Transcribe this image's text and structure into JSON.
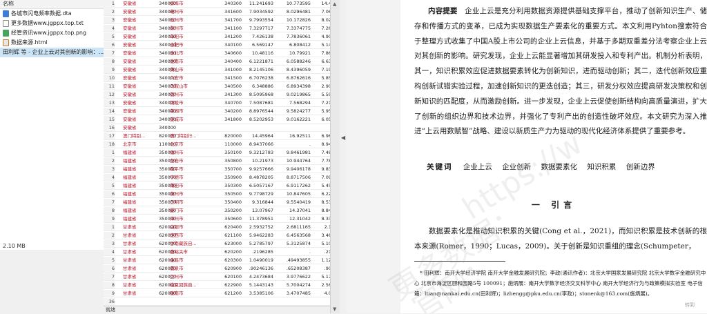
{
  "file_explorer": {
    "column_header": "名称",
    "files": [
      {
        "name": "各城市闪电频率数据.dta",
        "icon": "stata-dta-icon",
        "selected": false
      },
      {
        "name": "更多数据www.jgppx.top.txt",
        "icon": "text-file-icon",
        "selected": false
      },
      {
        "name": "经管资讯www.jgppx.top.png",
        "icon": "image-file-icon",
        "selected": false
      },
      {
        "name": "数据来源.html",
        "icon": "html-file-icon",
        "selected": false
      },
      {
        "name": "田利辉 等 - 企业上云对其创新的影响：...",
        "icon": "pdf-file-icon",
        "selected": true
      }
    ],
    "status_size": "2.10 MB"
  },
  "data_grid": {
    "rows": [
      {
        "n": "1",
        "prov": "安徽省",
        "pcode": "340000",
        "city": "蚌埠市",
        "ccode": "340300",
        "v1": "11.241693",
        "v2": "10.773595",
        "v3": "14.4"
      },
      {
        "n": "2",
        "prov": "安徽省",
        "pcode": "340000",
        "city": "亳州市",
        "ccode": "341600",
        "v1": "7.9034592",
        "v2": "8.0296481",
        "v3": "7.06"
      },
      {
        "n": "3",
        "prov": "安徽省",
        "pcode": "340000",
        "city": "池州市",
        "ccode": "341700",
        "v1": "9.7993554",
        "v2": "10.172826",
        "v3": "8.02"
      },
      {
        "n": "4",
        "prov": "安徽省",
        "pcode": "340000",
        "city": "滁州市",
        "ccode": "341100",
        "v1": "7.3297717",
        "v2": "7.3374775",
        "v3": "7.26"
      },
      {
        "n": "5",
        "prov": "安徽省",
        "pcode": "340000",
        "city": "阜阳市",
        "ccode": "341200",
        "v1": "7.426138",
        "v2": "7.7836061",
        "v3": "4.90"
      },
      {
        "n": "6",
        "prov": "安徽省",
        "pcode": "340000",
        "city": "合肥市",
        "ccode": "340100",
        "v1": "6.569147",
        "v2": "6.808412",
        "v3": "5.14"
      },
      {
        "n": "7",
        "prov": "安徽省",
        "pcode": "340000",
        "city": "淮北市",
        "ccode": "340600",
        "v1": "10.48116",
        "v2": "10.79921",
        "v3": "7.86"
      },
      {
        "n": "8",
        "prov": "安徽省",
        "pcode": "340000",
        "city": "淮南市",
        "ccode": "340400",
        "v1": "6.1221871",
        "v2": "6.0588246",
        "v3": "6.63"
      },
      {
        "n": "9",
        "prov": "安徽省",
        "pcode": "340000",
        "city": "黄山市",
        "ccode": "341000",
        "v1": "8.2145106",
        "v2": "8.4396059",
        "v3": "7.19"
      },
      {
        "n": "10",
        "prov": "安徽省",
        "pcode": "340000",
        "city": "六安市",
        "ccode": "341500",
        "v1": "6.7076238",
        "v2": "6.8762616",
        "v3": "5.85"
      },
      {
        "n": "11",
        "prov": "安徽省",
        "pcode": "340000",
        "city": "马鞍山市",
        "ccode": "340500",
        "v1": "6.348886",
        "v2": "6.8934398",
        "v3": "2.90"
      },
      {
        "n": "12",
        "prov": "安徽省",
        "pcode": "340000",
        "city": "宿州市",
        "ccode": "341300",
        "v1": "8.5095968",
        "v2": "9.0219865",
        "v3": "5.59"
      },
      {
        "n": "13",
        "prov": "安徽省",
        "pcode": "340000",
        "city": "铜陵市",
        "ccode": "340700",
        "v1": "7.5087681",
        "v2": "7.568294",
        "v3": "7.21"
      },
      {
        "n": "14",
        "prov": "安徽省",
        "pcode": "340000",
        "city": "芜湖市",
        "ccode": "340200",
        "v1": "8.8976544",
        "v2": "9.5824277",
        "v3": "5.95"
      },
      {
        "n": "15",
        "prov": "安徽省",
        "pcode": "340000",
        "city": "宣城市",
        "ccode": "341800",
        "v1": "8.5202953",
        "v2": "9.0162221",
        "v3": "6.05"
      },
      {
        "n": "16",
        "prov": "安徽省",
        "pcode": "340000",
        "city": "",
        "ccode": "",
        "v1": "",
        "v2": "",
        "v3": ""
      },
      {
        "n": "17",
        "prov": "澳门特别...",
        "pcode": "820000",
        "city": "澳门特别行...",
        "ccode": "820000",
        "v1": "14.45964",
        "v2": "16.92511",
        "v3": "6.96"
      },
      {
        "n": "18",
        "prov": "北京市",
        "pcode": "110000",
        "city": "北京市",
        "ccode": "110000",
        "v1": "8.9437066",
        "v2": ".",
        "v3": "8.94"
      },
      {
        "n": "1",
        "prov": "福建省",
        "pcode": "350000",
        "city": "福州市",
        "ccode": "350100",
        "v1": "9.3212783",
        "v2": "9.8461981",
        "v3": "7.48"
      },
      {
        "n": "2",
        "prov": "福建省",
        "pcode": "350000",
        "city": "龙岩市",
        "ccode": "350800",
        "v1": "10.21973",
        "v2": "10.944764",
        "v3": "7.78"
      },
      {
        "n": "3",
        "prov": "福建省",
        "pcode": "350000",
        "city": "南平市",
        "ccode": "350700",
        "v1": "9.9257666",
        "v2": "9.9406178",
        "v3": "9.83"
      },
      {
        "n": "4",
        "prov": "福建省",
        "pcode": "350000",
        "city": "宁德市",
        "ccode": "350900",
        "v1": "8.4878205",
        "v2": "8.8717506",
        "v3": "7.09"
      },
      {
        "n": "5",
        "prov": "福建省",
        "pcode": "350000",
        "city": "莆田市",
        "ccode": "350300",
        "v1": "6.5057167",
        "v2": "6.9117262",
        "v3": "5.45"
      },
      {
        "n": "6",
        "prov": "福建省",
        "pcode": "350000",
        "city": "泉州市",
        "ccode": "350500",
        "v1": "9.7798729",
        "v2": "10.847605",
        "v3": "6.22"
      },
      {
        "n": "7",
        "prov": "福建省",
        "pcode": "350000",
        "city": "三明市",
        "ccode": "350400",
        "v1": "9.316844",
        "v2": "9.5540419",
        "v3": "8.53"
      },
      {
        "n": "8",
        "prov": "福建省",
        "pcode": "350000",
        "city": "厦门市",
        "ccode": "350200",
        "v1": "13.07967",
        "v2": "14.37041",
        "v3": "8.84"
      },
      {
        "n": "9",
        "prov": "福建省",
        "pcode": "350000",
        "city": "漳州市",
        "ccode": "350600",
        "v1": "11.378951",
        "v2": "12.31042",
        "v3": "8.33"
      },
      {
        "n": "1",
        "prov": "甘肃省",
        "pcode": "620000",
        "city": "白银市",
        "ccode": "620400",
        "v1": "2.5932752",
        "v2": "2.6811165",
        "v3": "2.1"
      },
      {
        "n": "2",
        "prov": "甘肃省",
        "pcode": "620000",
        "city": "定西市",
        "ccode": "621100",
        "v1": "5.9462283",
        "v2": "6.4563568",
        "v3": "3.46"
      },
      {
        "n": "3",
        "prov": "甘肃省",
        "pcode": "620000",
        "city": "甘南藏族自...",
        "ccode": "623000",
        "v1": "5.2785797",
        "v2": "5.3125874",
        "v3": "5.10"
      },
      {
        "n": "4",
        "prov": "甘肃省",
        "pcode": "620000",
        "city": "嘉峪关市",
        "ccode": "620200",
        "v1": ".2196285",
        "v2": ".",
        "v3": ".21"
      },
      {
        "n": "5",
        "prov": "甘肃省",
        "pcode": "620000",
        "city": "金昌市",
        "ccode": "620300",
        "v1": "1.0490019",
        "v2": ".49493855",
        "v3": "1.12"
      },
      {
        "n": "6",
        "prov": "甘肃省",
        "pcode": "620000",
        "city": "酒泉市",
        "ccode": "620900",
        "v1": ".90246136",
        "v2": ".65208387",
        "v3": ".90"
      },
      {
        "n": "7",
        "prov": "甘肃省",
        "pcode": "620000",
        "city": "兰州市",
        "ccode": "620100",
        "v1": "4.2473684",
        "v2": "3.9776622",
        "v3": "5.17"
      },
      {
        "n": "8",
        "prov": "甘肃省",
        "pcode": "620000",
        "city": "临夏回族自...",
        "ccode": "622900",
        "v1": "5.1443143",
        "v2": "5.7004274",
        "v3": "2.56"
      },
      {
        "n": "9",
        "prov": "甘肃省",
        "pcode": "620000",
        "city": "陇南市",
        "ccode": "621200",
        "v1": "3.5385106",
        "v2": "3.4707485",
        "v3": "4.0"
      },
      {
        "n": "36",
        "prov": "",
        "pcode": "",
        "city": "",
        "ccode": "",
        "v1": "",
        "v2": "",
        "v3": ""
      }
    ],
    "status": "就绪"
  },
  "pdf": {
    "abstract_label": "内容提要",
    "abstract_text": "企业上云是充分利用数据资源提供基础支撑平台，推动了创新知识生产、储存和传播方式的变革，已成为实现数据生产要素化的重要方式。本文利用Pyhton搜索符合于整理方式收集了中国A股上市公司的企业上云信息，并基于多期双重差分法考察企业上云对其创新的影响。研究发现，企业上云能显著增加其研发投入和专利产出。机制分析表明，其一，知识积累效应促进数据要素转化为创新知识，进而驱动创新；其二，迭代创新效应重构创新试错实验过程，加速创新知识的更迭创造；其三，研发分权效应提高研发决策权和创新知识的匹配度，从而激励创新。进一步发现，企业上云促使创新结构向高质量演进，扩大了创新的组织边界和技术边界，并强化了专利产出的创造性破坏效应。本文研究为深入推进“上云用数赋智”战略、建设以新质生产力为驱动的现代化经济体系提供了重要参考。",
    "keywords_label": "关键词",
    "keywords": [
      "企业上云",
      "企业创新",
      "数据要素化",
      "知识积累",
      "创新边界"
    ],
    "section_title": "一 引言",
    "intro_text": "数据要素化是推动知识积累的关键(Cong et al.，2021)，而知识积累是技术创新的根本来源(Romer，1990；Lucas，2009)。关于创新是知识重组的理念(Schumpeter，",
    "footnote": "* 田利辉：南开大学经济学院 南开大学金融发展研究院；李政(通讯作者)：北京大学国家发展研究院 北京大学数字金融研究中心 北京市海淀区颐和园路5号 100091；施炳展：南开大学数字经济交叉科学中心 南开大学经济行为与政策模拟实验室 电子信箱：ltian@nankai.edu.cn(田利辉)；lizhengg@pku.edu.cn(李政)；stonenk@163.com(施炳展)。",
    "watermarks": [
      "更多数据：",
      "https://w",
      "官网："
    ],
    "badge": "转到"
  }
}
